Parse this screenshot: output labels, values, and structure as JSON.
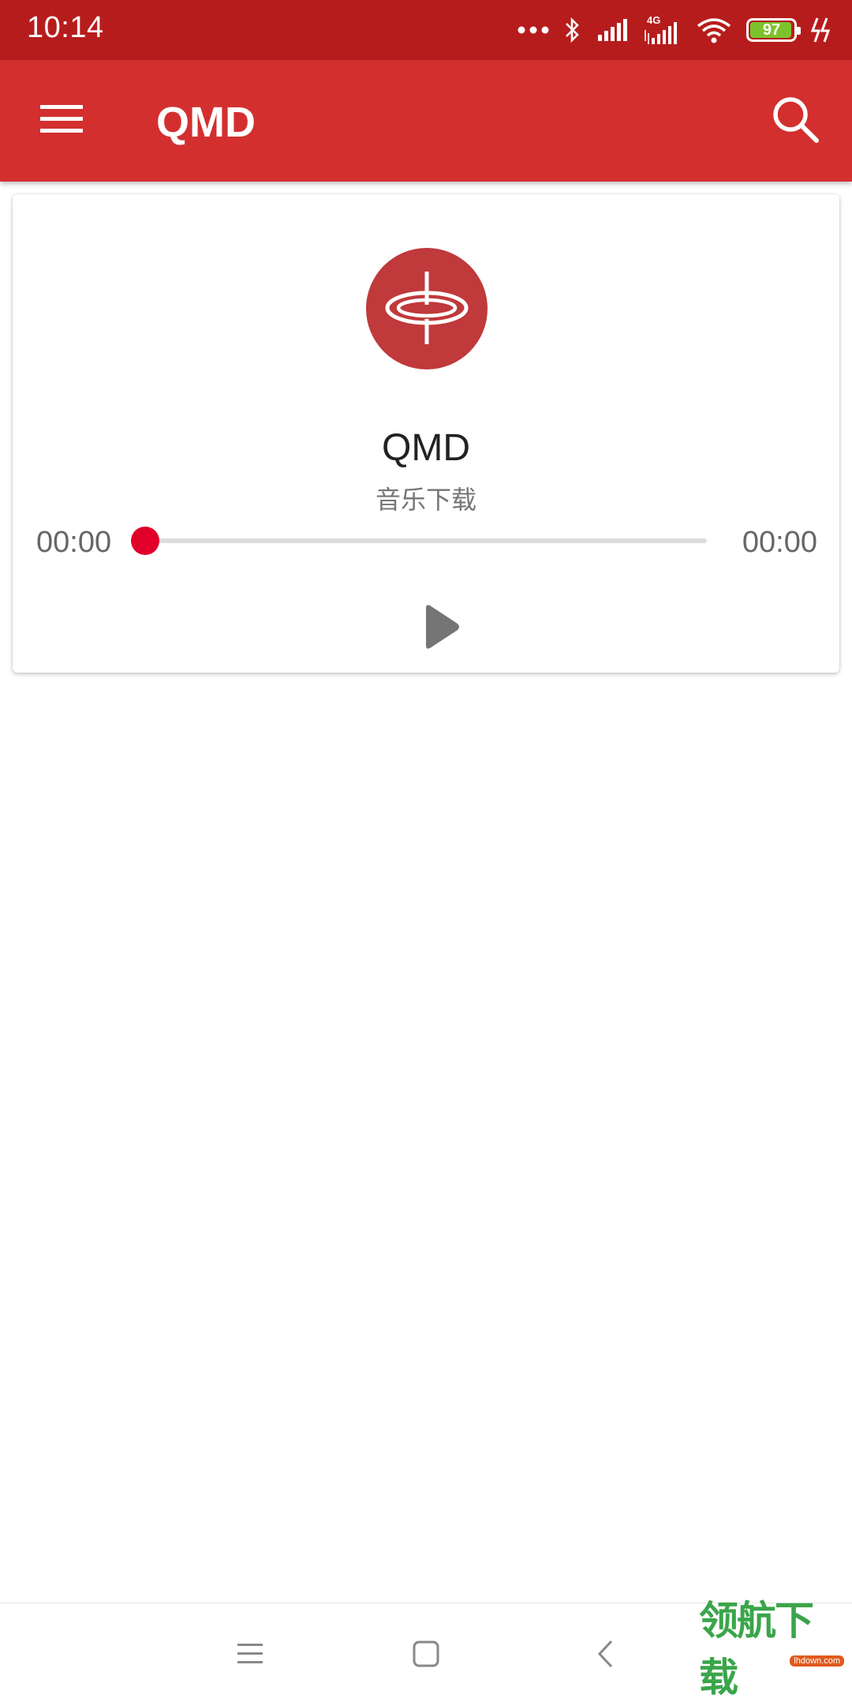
{
  "status_bar": {
    "time": "10:14",
    "network": "4G",
    "battery_level": "97",
    "battery_fraction": 0.97,
    "icons": [
      "more-dots-icon",
      "bluetooth-icon",
      "signal-icon",
      "signal-4g-icon",
      "wifi-icon",
      "battery-icon",
      "charging-icon"
    ]
  },
  "app_bar": {
    "title": "QMD",
    "menu_icon": "hamburger-menu-icon",
    "search_icon": "search-icon"
  },
  "player": {
    "title": "QMD",
    "subtitle": "音乐下载",
    "current_time": "00:00",
    "total_time": "00:00",
    "progress": 0,
    "logo_icon": "spinning-top-icon",
    "play_icon": "play-icon"
  },
  "nav_bar": {
    "icons": [
      "recent-apps-icon",
      "home-icon",
      "back-icon"
    ]
  },
  "watermark": {
    "text": "领航下载",
    "badge": "lhdown.com"
  },
  "colors": {
    "status_bar": "#b71c1c",
    "app_bar": "#d32f2f",
    "accent": "#e0002a",
    "logo": "#c0393b",
    "watermark": "#3aa54a"
  }
}
